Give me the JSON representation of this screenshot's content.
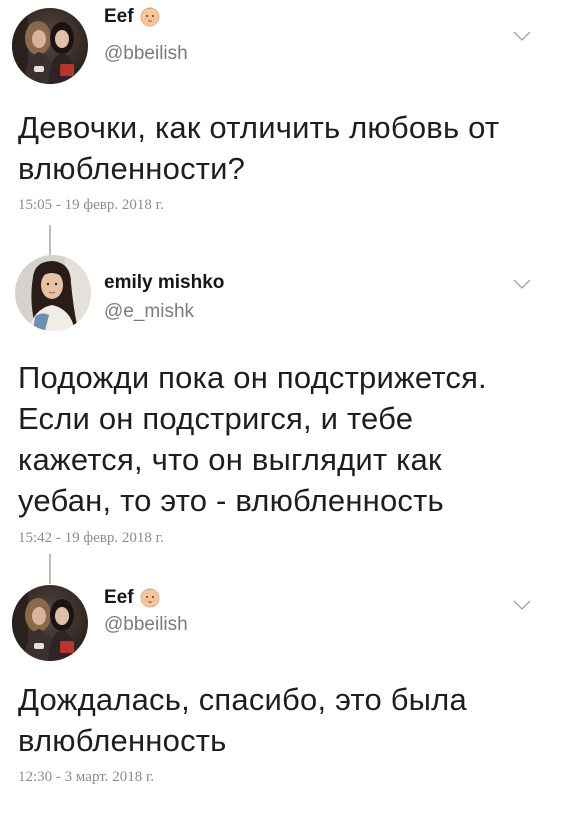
{
  "tweets": [
    {
      "author": {
        "name": "Eef",
        "handle": "@bbeilish",
        "name_emoji_icon": "baby-emoji-icon",
        "avatar_icon": "avatar-photo"
      },
      "text_lines": [
        "Девочки, как отличить любовь от",
        "влюбленности?"
      ],
      "timestamp": "15:05 - 19 февр. 2018 г.",
      "menu_icon": "chevron-down-icon"
    },
    {
      "author": {
        "name": "emily mishko",
        "handle": "@e_mishk",
        "avatar_icon": "avatar-photo"
      },
      "text_lines": [
        "Подожди пока он подстрижется.",
        "Если он подстригся, и тебе",
        "кажется, что он выглядит как",
        "уебан, то это - влюбленность"
      ],
      "timestamp": "15:42 - 19 февр. 2018 г.",
      "menu_icon": "chevron-down-icon"
    },
    {
      "author": {
        "name": "Eef",
        "handle": "@bbeilish",
        "name_emoji_icon": "baby-emoji-icon",
        "avatar_icon": "avatar-photo"
      },
      "text_lines": [
        "Дождалась, спасибо, это была",
        "влюбленность"
      ],
      "timestamp": "12:30 - 3 март. 2018 г.",
      "menu_icon": "chevron-down-icon"
    }
  ],
  "colors": {
    "background": "#ffffff",
    "name": "#14171a",
    "handle": "#7b7b7b",
    "text": "#1e1e1e",
    "timestamp": "#8c8c8c",
    "thread_line": "#bdbdbd",
    "chevron": "#9aa5b1"
  }
}
